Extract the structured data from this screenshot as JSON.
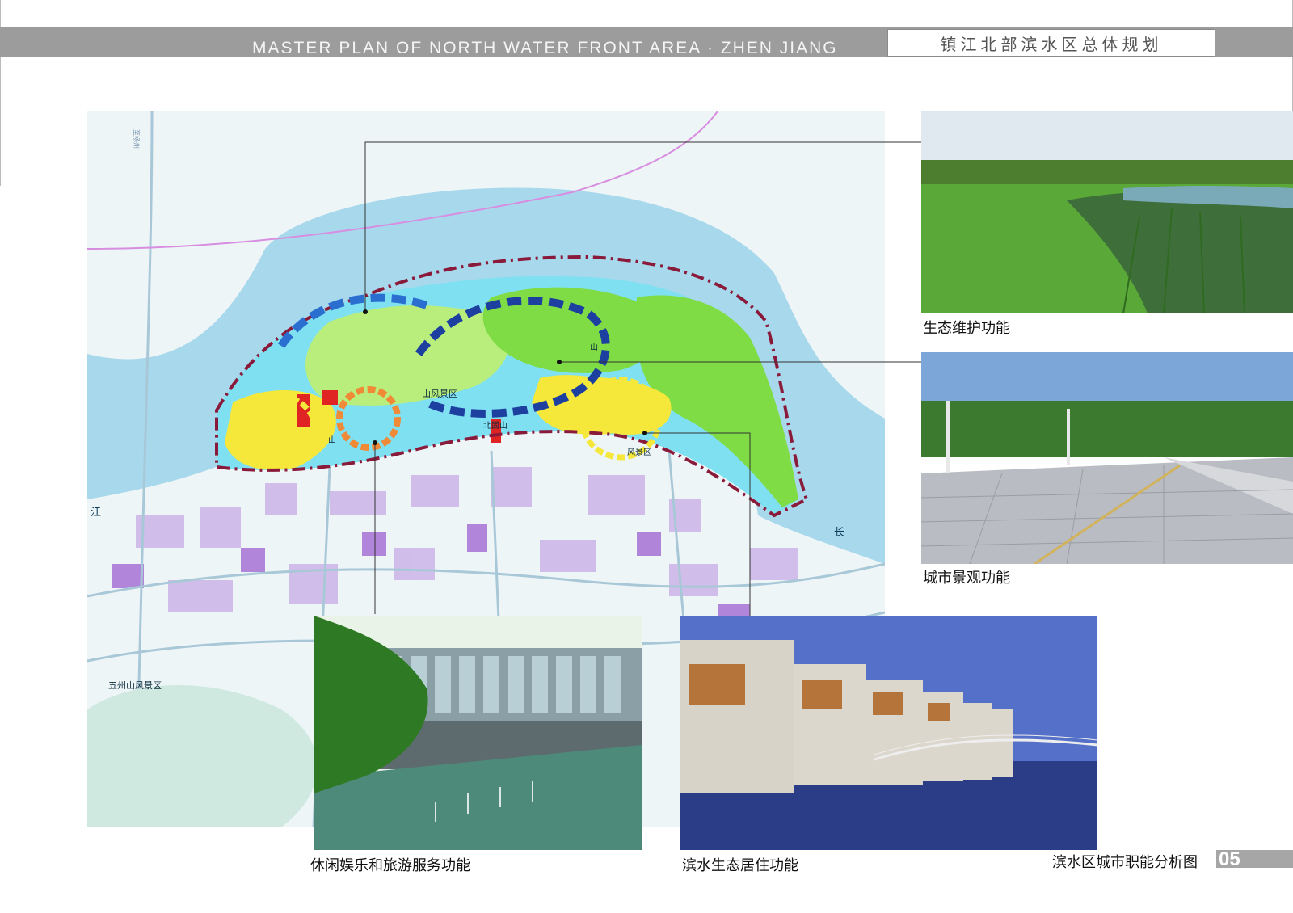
{
  "header": {
    "title_en": "MASTER PLAN OF NORTH WATER FRONT AREA · ZHEN  JIANG",
    "title_cn": "镇江北部滨水区总体规划"
  },
  "map": {
    "labels": {
      "scenic_area": "山风景区",
      "beigu_shan": "北固山",
      "shan_left": "山",
      "shan_top": "山",
      "feng_area": "风景区",
      "jiang": "江",
      "chang": "长",
      "wuzhou_scenic": "五州山风景区",
      "road_vertical": "至扬州"
    }
  },
  "photos": {
    "ecology": {
      "caption": "生态维护功能"
    },
    "landscape": {
      "caption": "城市景观功能"
    },
    "leisure": {
      "caption": "休闲娱乐和旅游服务功能"
    },
    "living": {
      "caption": "滨水生态居住功能"
    }
  },
  "footer": {
    "title": "滨水区城市职能分析图",
    "page": "05"
  },
  "colors": {
    "header_bar": "#9c9c9c",
    "water": "#a8d8ec",
    "river_inner": "#7fe0f2",
    "green": "#7fdc45",
    "light_green": "#b9ee7c",
    "boundary": "#8a1a3a",
    "accent_blue": "#1c3fa0",
    "yellow": "#f5e83a",
    "orange": "#f08a36"
  }
}
